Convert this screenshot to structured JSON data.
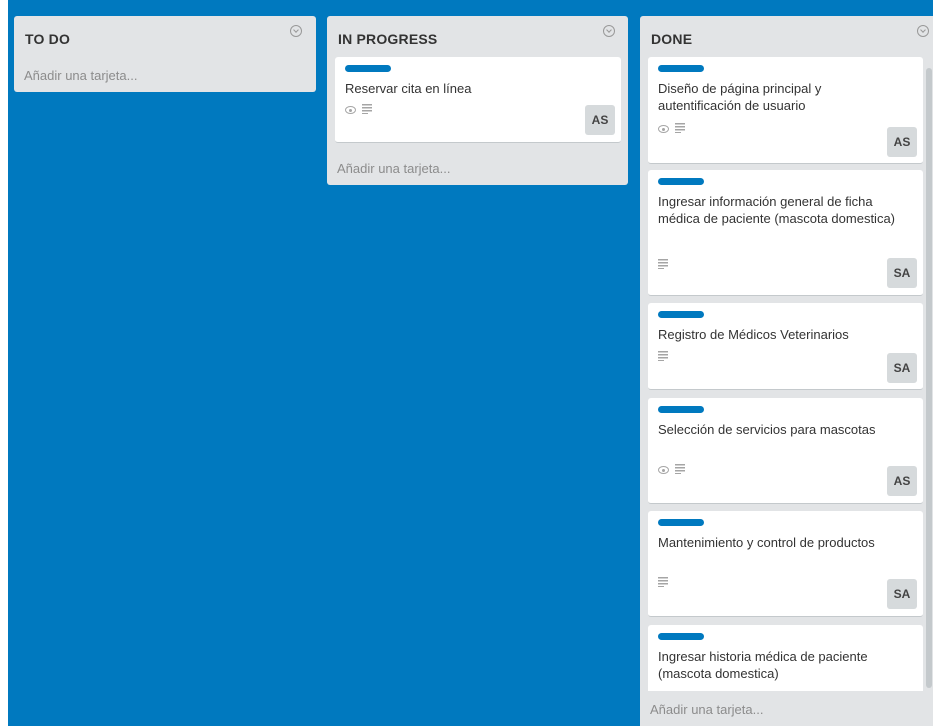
{
  "colors": {
    "board_background": "#0079bf",
    "list_background": "#e2e4e6",
    "label_blue": "#0079bf"
  },
  "lists": [
    {
      "title": "TO DO",
      "add_card_label": "Añadir una tarjeta...",
      "cards": []
    },
    {
      "title": "IN PROGRESS",
      "add_card_label": "Añadir una tarjeta...",
      "cards": [
        {
          "title": "Reservar cita en línea",
          "label_color": "#0079bf",
          "badges": [
            "eye-icon",
            "description-icon"
          ],
          "member": "AS"
        }
      ]
    },
    {
      "title": "DONE",
      "add_card_label": "Añadir una tarjeta...",
      "cards": [
        {
          "title": "Diseño de página principal y autentificación de usuario",
          "label_color": "#0079bf",
          "badges": [
            "eye-icon",
            "description-icon"
          ],
          "member": "AS"
        },
        {
          "title": "Ingresar información general de ficha médica de paciente (mascota domestica)",
          "label_color": "#0079bf",
          "badges": [
            "description-icon"
          ],
          "member": "SA"
        },
        {
          "title": "Registro de Médicos Veterinarios",
          "label_color": "#0079bf",
          "badges": [
            "description-icon"
          ],
          "member": "SA"
        },
        {
          "title": "Selección de servicios para mascotas",
          "label_color": "#0079bf",
          "badges": [
            "eye-icon",
            "description-icon"
          ],
          "member": "AS"
        },
        {
          "title": "Mantenimiento y control de productos",
          "label_color": "#0079bf",
          "badges": [
            "description-icon"
          ],
          "member": "SA"
        },
        {
          "title": "Ingresar historia médica de paciente (mascota domestica)",
          "label_color": "#0079bf",
          "badges": [],
          "member": ""
        }
      ]
    }
  ]
}
